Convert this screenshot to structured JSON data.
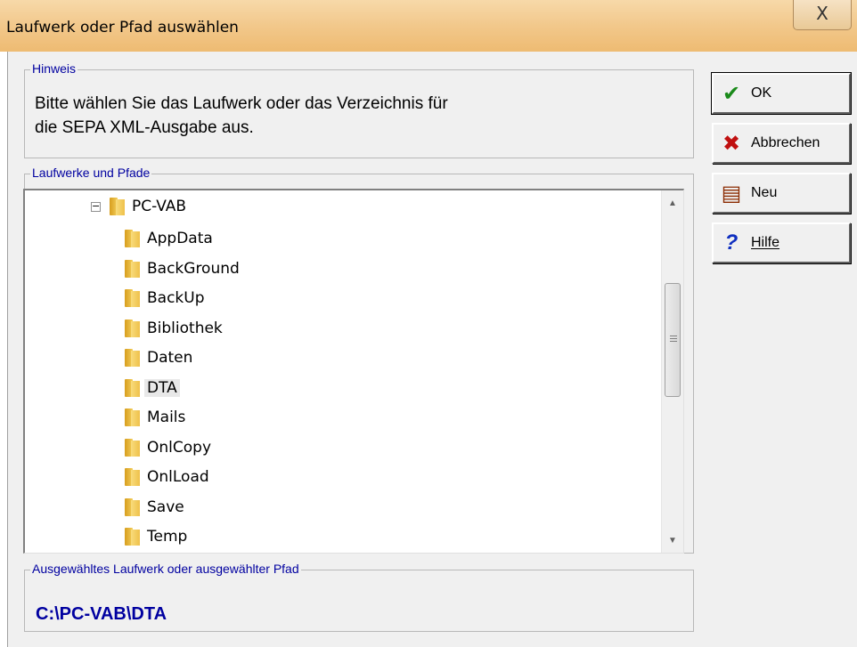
{
  "window": {
    "title": "Laufwerk oder Pfad auswählen",
    "close_glyph": "X"
  },
  "hint": {
    "label": "Hinweis",
    "line1": "Bitte wählen Sie das Laufwerk oder das Verzeichnis für",
    "line2": "die SEPA XML-Ausgabe aus."
  },
  "tree": {
    "label": "Laufwerke und Pfade",
    "root": {
      "name": "PC-VAB",
      "expander": "−"
    },
    "children": [
      {
        "name": "AppData"
      },
      {
        "name": "BackGround"
      },
      {
        "name": "BackUp"
      },
      {
        "name": "Bibliothek"
      },
      {
        "name": "Daten"
      },
      {
        "name": "DTA",
        "selected": true
      },
      {
        "name": "Mails"
      },
      {
        "name": "OnlCopy"
      },
      {
        "name": "OnlLoad"
      },
      {
        "name": "Save"
      },
      {
        "name": "Temp"
      }
    ],
    "scroll_up_glyph": "▲",
    "scroll_down_glyph": "▼"
  },
  "selected_path": {
    "label": "Ausgewähltes Laufwerk oder ausgewählter Pfad",
    "value": "C:\\PC-VAB\\DTA"
  },
  "buttons": {
    "ok": {
      "label": "OK",
      "icon": "checkmark-icon",
      "glyph": "✔",
      "color": "#1a8a1a"
    },
    "cancel": {
      "label": "Abbrechen",
      "icon": "cross-icon",
      "glyph": "✖",
      "color": "#c01010"
    },
    "new": {
      "label": "Neu",
      "icon": "document-list-icon",
      "glyph": "▤",
      "color": "#8a2a00"
    },
    "help": {
      "label": "Hilfe",
      "icon": "question-icon",
      "glyph": "?",
      "color": "#1030c0"
    }
  },
  "colors": {
    "titlebar": "#f2c88b",
    "group_label": "#0000a0",
    "path_text": "#0000a0"
  }
}
